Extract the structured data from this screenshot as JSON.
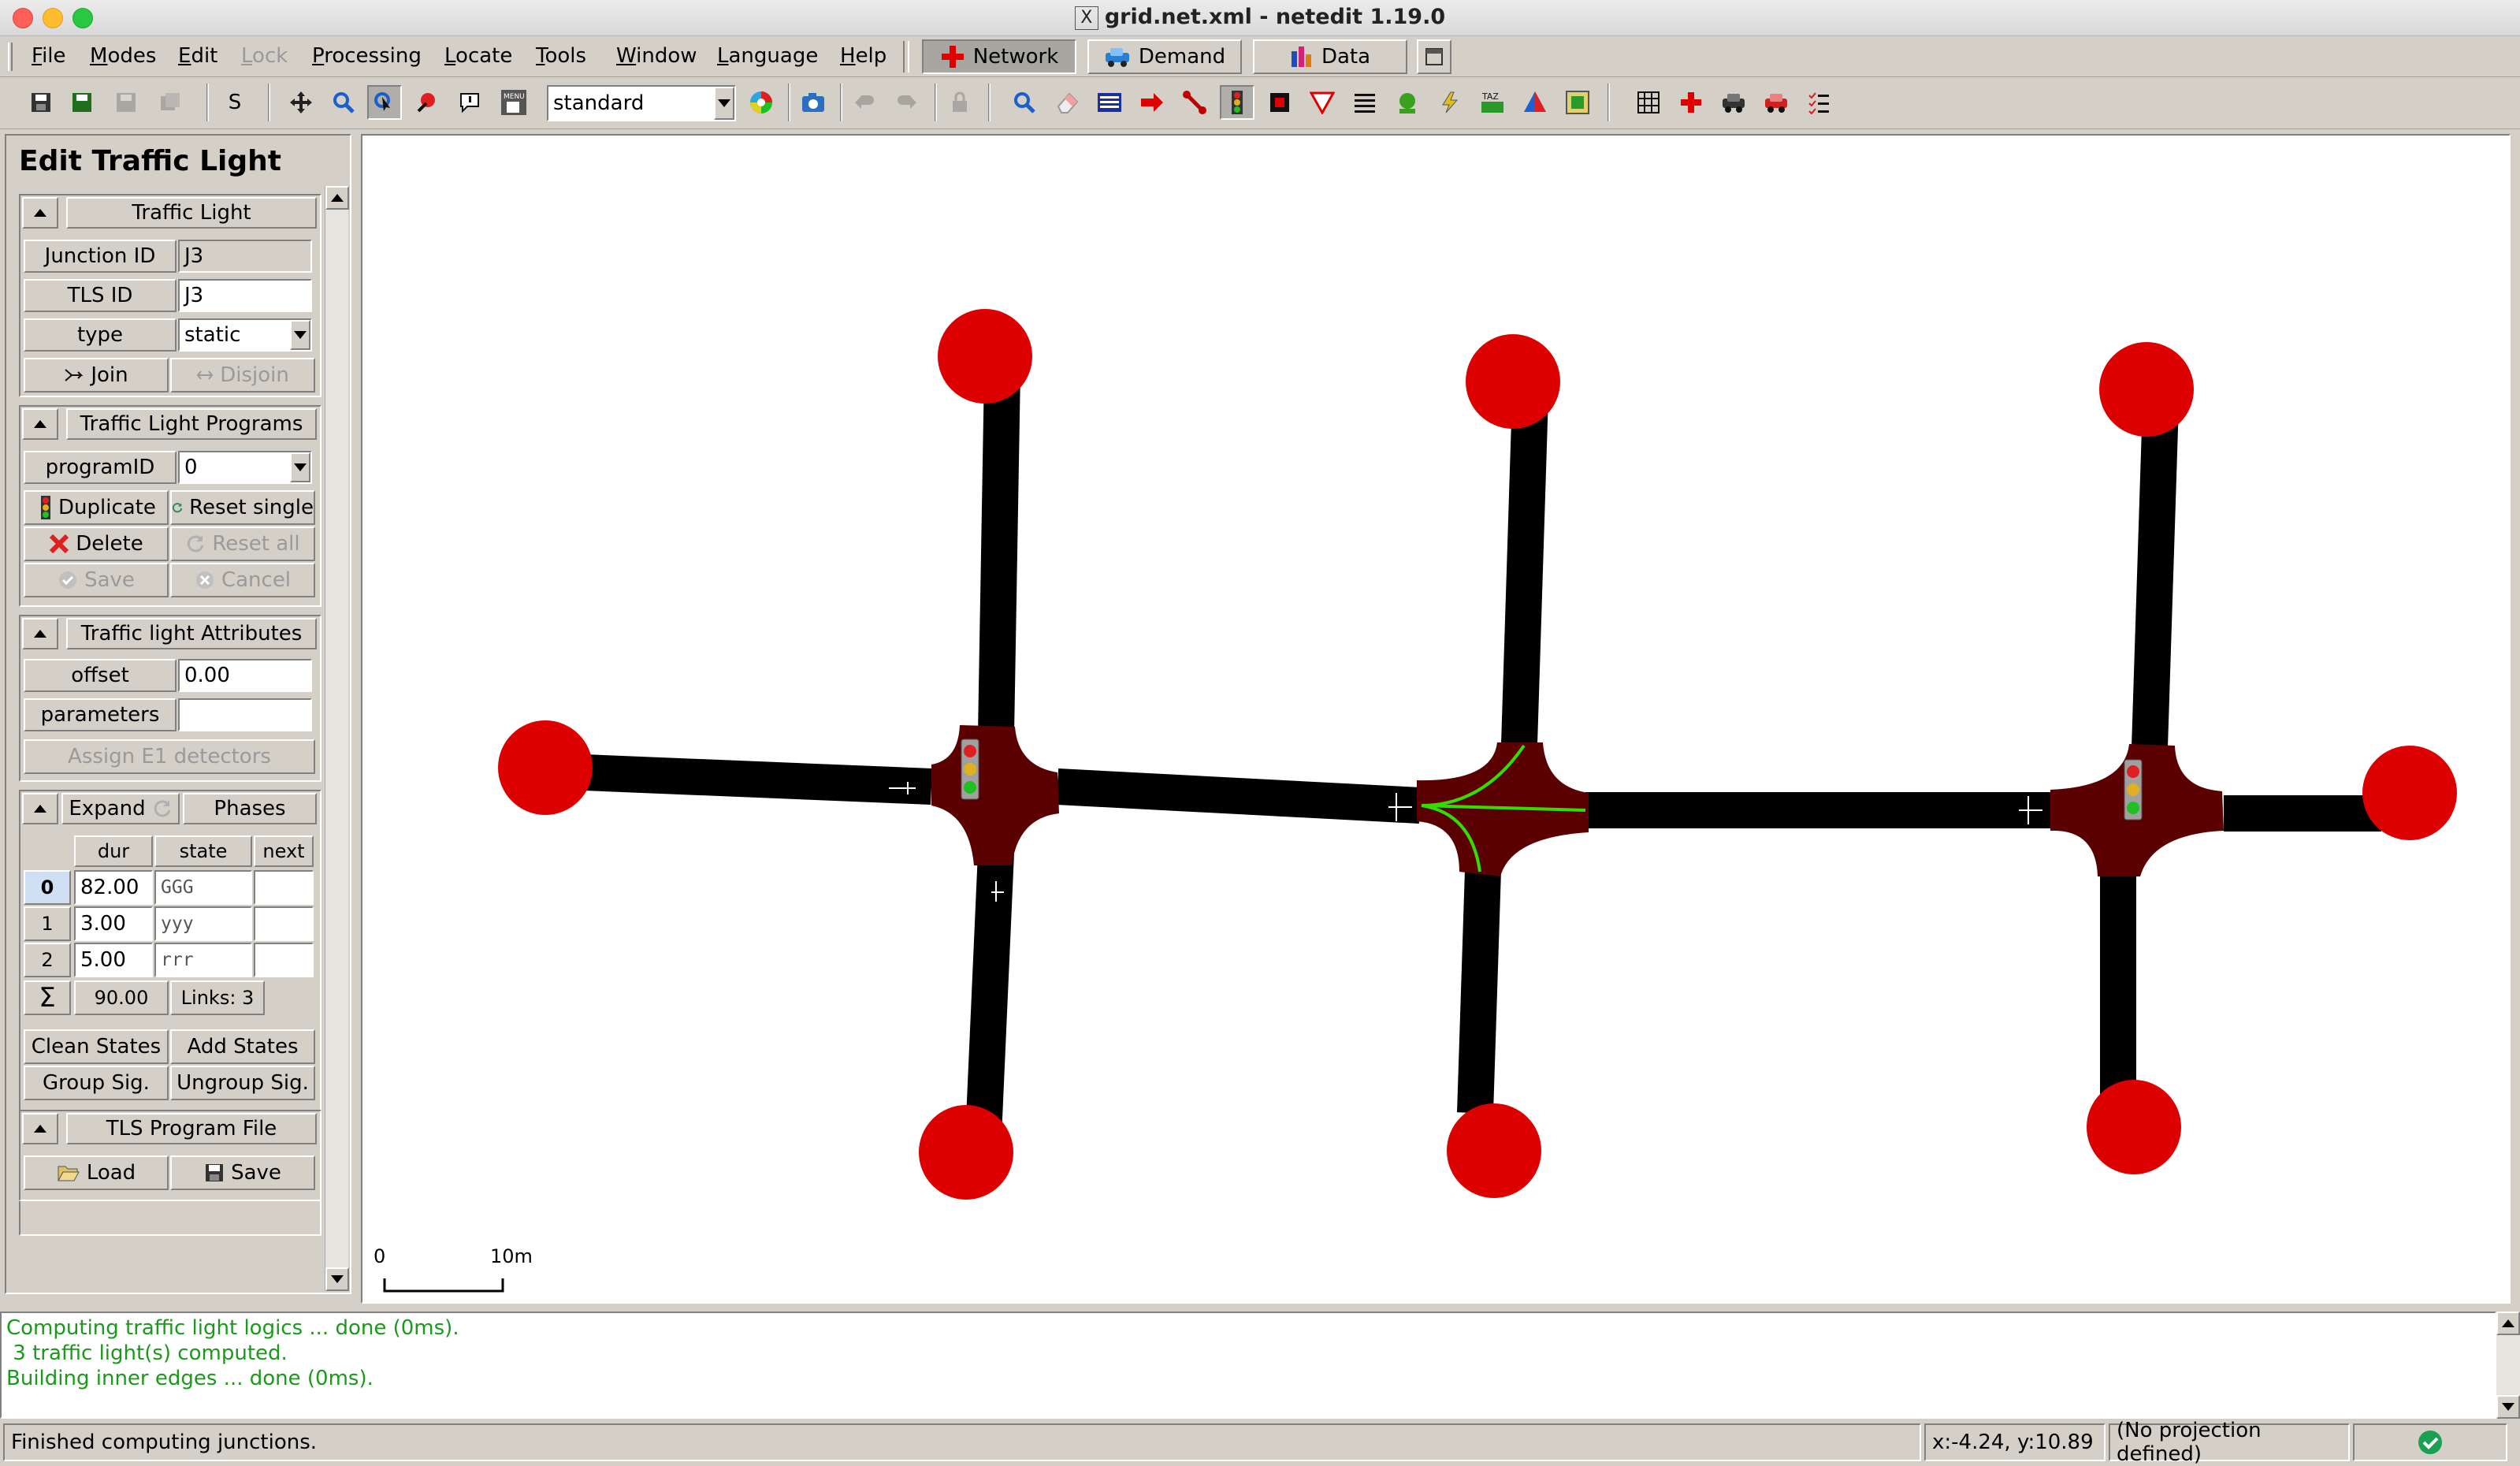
{
  "window": {
    "title": "grid.net.xml - netedit 1.19.0"
  },
  "menu": [
    "File",
    "Modes",
    "Edit",
    "Lock",
    "Processing",
    "Locate",
    "Tools",
    "Window",
    "Language",
    "Help"
  ],
  "modes": {
    "network": "Network",
    "demand": "Demand",
    "data": "Data"
  },
  "toolbar": {
    "s_label": "S",
    "view_scheme": "standard"
  },
  "panel": {
    "title": "Edit Traffic Light",
    "traffic_light": {
      "header": "Traffic Light",
      "junction_id_label": "Junction ID",
      "junction_id_value": "J3",
      "tls_id_label": "TLS ID",
      "tls_id_value": "J3",
      "type_label": "type",
      "type_value": "static",
      "join": "Join",
      "disjoin": "Disjoin"
    },
    "programs": {
      "header": "Traffic Light Programs",
      "program_id_label": "programID",
      "program_id_value": "0",
      "duplicate": "Duplicate",
      "reset_single": "Reset single",
      "delete": "Delete",
      "reset_all": "Reset all",
      "save": "Save",
      "cancel": "Cancel"
    },
    "attributes": {
      "header": "Traffic light Attributes",
      "offset_label": "offset",
      "offset_value": "0.00",
      "parameters_label": "parameters",
      "parameters_value": "",
      "assign_e1": "Assign E1 detectors"
    },
    "phases": {
      "expand": "Expand",
      "header": "Phases",
      "columns": [
        "dur",
        "state",
        "next"
      ],
      "rows": [
        {
          "index": "0",
          "dur": "82.00",
          "state": "GGG",
          "next": ""
        },
        {
          "index": "1",
          "dur": "3.00",
          "state": "yyy",
          "next": ""
        },
        {
          "index": "2",
          "dur": "5.00",
          "state": "rrr",
          "next": ""
        }
      ],
      "sum_symbol": "Σ",
      "total": "90.00",
      "links": "Links: 3",
      "clean_states": "Clean States",
      "add_states": "Add States",
      "group_sig": "Group Sig.",
      "ungroup_sig": "Ungroup Sig."
    },
    "file": {
      "header": "TLS Program File",
      "load": "Load",
      "save": "Save"
    }
  },
  "canvas": {
    "scale_start": "0",
    "scale_end": "10m"
  },
  "messages": [
    "Computing traffic light logics ... done (0ms).",
    " 3 traffic light(s) computed.",
    "Building inner edges ... done (0ms)."
  ],
  "status": {
    "text": "Finished computing junctions.",
    "coords": "x:-4.24, y:10.89",
    "projection": "(No projection defined)"
  },
  "colors": {
    "node_red": "#dd0000",
    "junction": "#5a0000",
    "road": "#000000",
    "connection": "#33dd00",
    "message_green": "#1a9a1a"
  }
}
